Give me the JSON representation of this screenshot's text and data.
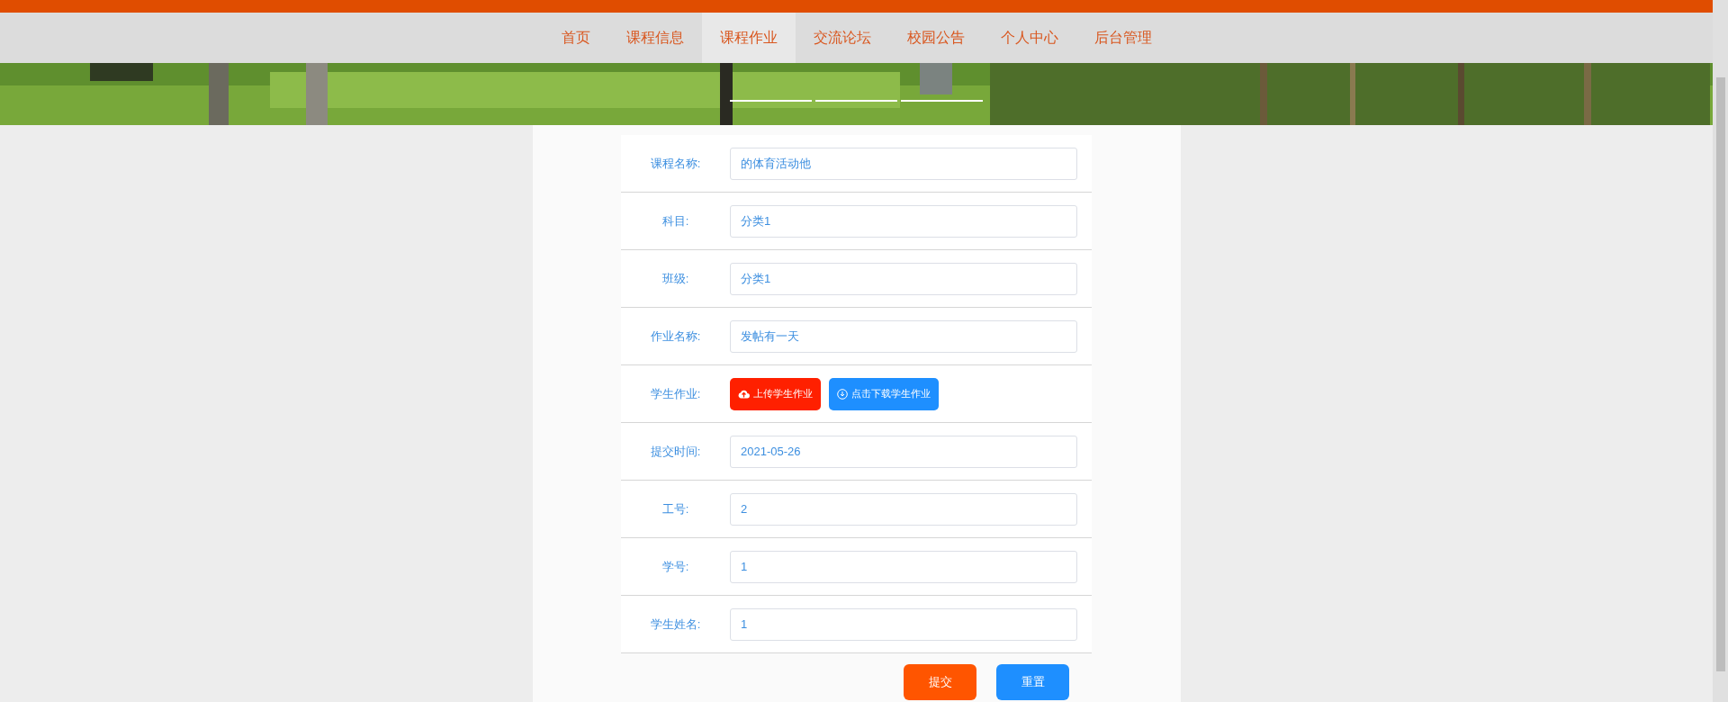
{
  "nav": [
    {
      "label": "首页",
      "selected": false
    },
    {
      "label": "课程信息",
      "selected": false
    },
    {
      "label": "课程作业",
      "selected": true
    },
    {
      "label": "交流论坛",
      "selected": false
    },
    {
      "label": "校园公告",
      "selected": false
    },
    {
      "label": "个人中心",
      "selected": false
    },
    {
      "label": "后台管理",
      "selected": false
    }
  ],
  "banner": {
    "kind": "picture",
    "indicators": [
      {
        "selected": false
      },
      {
        "selected": false
      },
      {
        "selected": false
      }
    ]
  },
  "form": {
    "rows": [
      {
        "kind": "field",
        "label": "课程名称:",
        "value": "的体育活动他"
      },
      {
        "kind": "field",
        "label": "科目:",
        "value": "分类1"
      },
      {
        "kind": "field",
        "label": "班级:",
        "value": "分类1"
      },
      {
        "kind": "field",
        "label": "作业名称:",
        "value": "发帖有一天"
      },
      {
        "kind": "buttons",
        "label": "学生作业:",
        "buttons": [
          {
            "label": "上传学生作业",
            "kind": "upload"
          },
          {
            "label": "点击下载学生作业",
            "kind": "download"
          }
        ]
      },
      {
        "kind": "field",
        "label": "提交时间:",
        "value": "2021-05-26"
      },
      {
        "kind": "field",
        "label": "工号:",
        "value": "2"
      },
      {
        "kind": "field",
        "label": "学号:",
        "value": "1"
      },
      {
        "kind": "field",
        "label": "学生姓名:",
        "value": "1"
      }
    ],
    "actions": [
      {
        "label": "提交",
        "kind": "submit"
      },
      {
        "label": "重置",
        "kind": "reset"
      }
    ]
  }
}
